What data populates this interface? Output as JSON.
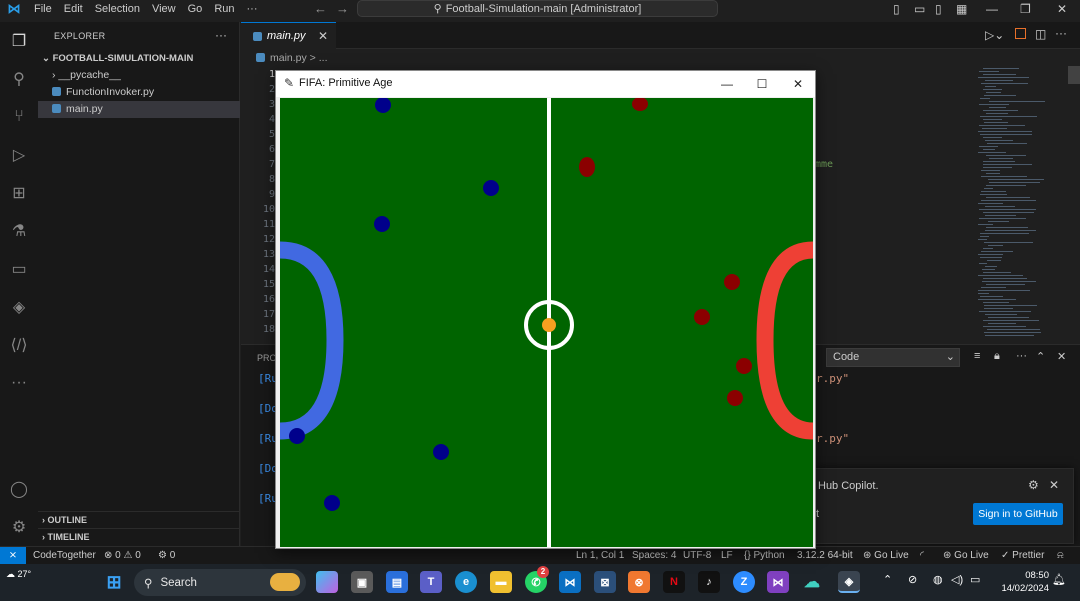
{
  "titlebar": {
    "menu": [
      "File",
      "Edit",
      "Selection",
      "View",
      "Go",
      "Run",
      "···"
    ],
    "search_text": "Football-Simulation-main [Administrator]"
  },
  "explorer": {
    "title": "EXPLORER",
    "project": "FOOTBALL-SIMULATION-MAIN",
    "items": [
      {
        "label": "__pycache__",
        "kind": "folder"
      },
      {
        "label": "FunctionInvoker.py",
        "kind": "file"
      },
      {
        "label": "main.py",
        "kind": "file",
        "selected": true
      }
    ],
    "outline": "OUTLINE",
    "timeline": "TIMELINE"
  },
  "editor": {
    "tab_label": "main.py",
    "breadcrumb": "main.py > ...",
    "line_numbers": [
      "1",
      "2",
      "3",
      "4",
      "5",
      "6",
      "7",
      "8",
      "9",
      "10",
      "11",
      "12",
      "13",
      "14",
      "15",
      "16",
      "17",
      "18"
    ],
    "code_fragment": "mme"
  },
  "panel": {
    "tab_fragment": "PROB",
    "terminal_lines": [
      "[Ru",
      "[Do",
      "[Ru",
      "[Do",
      "[Ru"
    ],
    "terminal_strings": [
      "r.py\"",
      "r.py\""
    ],
    "terminal_select": "Code"
  },
  "notification": {
    "text": "Hub Copilot.",
    "text2": "t",
    "button": "Sign in to GitHub"
  },
  "statusbar": {
    "left": [
      "CodeTogether",
      "⊗ 0 ⚠ 0",
      "⚙ 0"
    ],
    "right": [
      "Ln 1, Col 1",
      "Spaces: 4",
      "UTF-8",
      "LF",
      "{} Python",
      "3.12.2 64-bit",
      "Go Live",
      "Go Live",
      "Prettier"
    ]
  },
  "game_window": {
    "title": "FIFA: Primitive Age",
    "colors": {
      "pitch": "#006400",
      "blue_team": "#00008b",
      "red_team": "#8b0000",
      "blue_goal": "#4169e1",
      "red_goal": "#ee4035",
      "ball": "#f5a020",
      "lines": "#ffffff"
    }
  },
  "taskbar": {
    "weather": "27°",
    "search": "Search",
    "time": "08:50",
    "date": "14/02/2024",
    "whatsapp_badge": "2"
  }
}
